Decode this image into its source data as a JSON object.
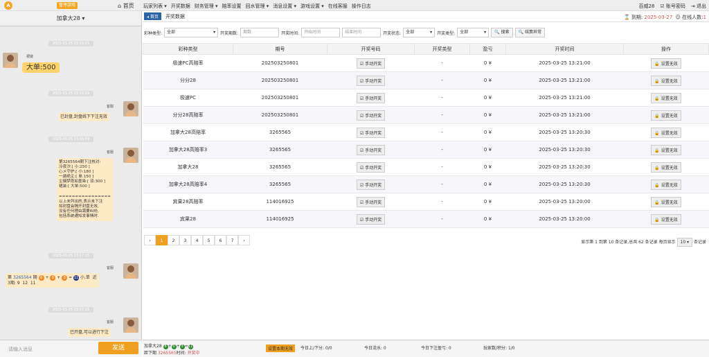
{
  "top": {
    "logo": "A",
    "pause": "暂停游戏",
    "home": "首页",
    "menu": [
      "玩家列表 ▾",
      "开奖数据",
      "财务管理 ▾",
      "赔率设置",
      "回水管理 ▾",
      "消息设置 ▾",
      "游戏设置 ▾",
      "在线客服",
      "操作日志"
    ],
    "right": [
      "百威28",
      "账号密码",
      "退出"
    ]
  },
  "left": {
    "room": "加拿大28 ▾",
    "input_placeholder": "请输入消息",
    "send": "发送",
    "ts": [
      "2025-03-25 13:16:03",
      "2025-03-25 13:16:29",
      "2025-03-25 13:16:59",
      "2025-03-25 13:17:15",
      "2025-03-25 13:17:15"
    ],
    "msgs": [
      {
        "name": "裙装",
        "text": "大单:500"
      },
      {
        "name": "客服",
        "text": "已封盘,封盘线下下注无效"
      },
      {
        "name": "客服",
        "text": "第3265564期下注核对:\n冷夜汐:[ 小:250 ]\n心メ守护:[ 小:180 ]\n一骑绝尘:[ 单:150 ]\n尘烟梦雨如墨染:[ 双:300 ]\n裙装:[ 大单:500 ]\n\n================\n以上未列出的,表示未下注\n如封盘会隔开封盘无效,\n没有任何理由需要纠纷,\n包括系统通知发事情时."
      },
      {
        "name": "客服",
        "text_a": "第",
        "issue": "3265564",
        "text_b": "期",
        "b1": "8",
        "b2": "0",
        "b3": "3",
        "sum": "11",
        "result": "小,单  近",
        "recent": "3期: 9  12  11"
      },
      {
        "name": "客服",
        "text": "已开盘,可以进行下注"
      }
    ]
  },
  "main": {
    "tabs": [
      "首页",
      "开奖数据"
    ],
    "expire_label": "到期:",
    "expire": "2025-03-27",
    "online_label": "在线人数:",
    "online": "1",
    "filter": {
      "type_label": "彩种类型:",
      "type_value": "全部",
      "period_label": "开奖期数:",
      "period_ph": "期数",
      "time_label": "开奖时间:",
      "start_ph": "开始时间",
      "end_ph": "结束时间",
      "status_label": "开奖状态:",
      "status_value": "全部",
      "kind_label": "开奖类型:",
      "kind_value": "全部",
      "search": "搜索",
      "settle": "结算异常"
    },
    "headers": [
      "彩种类型",
      "期号",
      "开奖号码",
      "开奖类型",
      "盈亏",
      "开奖时间",
      "操作"
    ],
    "manual": "手动开奖",
    "invalid": "设置无效",
    "rows": [
      [
        "极速PC高赔率",
        "202503250801",
        "-",
        "0 ¥",
        "2025-03-25 13:21:00"
      ],
      [
        "分分28",
        "202503250801",
        "-",
        "0 ¥",
        "2025-03-25 13:21:00"
      ],
      [
        "极速PC",
        "202503250801",
        "-",
        "0 ¥",
        "2025-03-25 13:21:00"
      ],
      [
        "分分28高赔率",
        "202503250801",
        "-",
        "0 ¥",
        "2025-03-25 13:21:00"
      ],
      [
        "加拿大28高赔率",
        "3265565",
        "-",
        "0 ¥",
        "2025-03-25 13:20:30"
      ],
      [
        "加拿大28高赔率3",
        "3265565",
        "-",
        "0 ¥",
        "2025-03-25 13:20:30"
      ],
      [
        "加拿大28",
        "3265565",
        "-",
        "0 ¥",
        "2025-03-25 13:20:30"
      ],
      [
        "加拿大28高赔率4",
        "3265565",
        "-",
        "0 ¥",
        "2025-03-25 13:20:30"
      ],
      [
        "宾果28高赔率",
        "114016925",
        "-",
        "0 ¥",
        "2025-03-25 13:20:00"
      ],
      [
        "宾果28",
        "114016925",
        "-",
        "0 ¥",
        "2025-03-25 13:20:00"
      ]
    ],
    "pages": [
      "‹",
      "1",
      "2",
      "3",
      "4",
      "5",
      "6",
      "7",
      "›"
    ],
    "page_info": "显示第 1 到第 10 条记录,总共 62 条记录  每页显示",
    "per_page": "10 ▾",
    "per_unit": "条记录"
  },
  "footer": {
    "game": "加拿大28",
    "n1": "8",
    "n2": "0",
    "n3": "3",
    "sum": "11",
    "next_label": "距下期",
    "next_issue": "3265565",
    "next_time": "时间:",
    "status": "开奖中",
    "set_invalid": "设置本期无效",
    "stats": [
      "今日上/下分: 0/0",
      "今日流水: 0",
      "今日下注盈亏: 0",
      "玩家数/积分: 1/0"
    ]
  }
}
